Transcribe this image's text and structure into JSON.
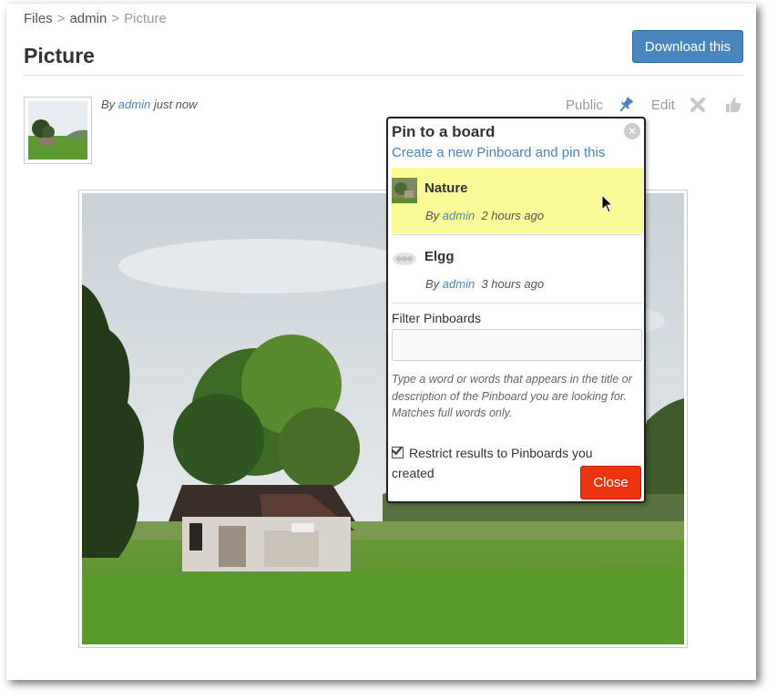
{
  "breadcrumb": {
    "files": "Files",
    "sep1": ">",
    "admin": "admin",
    "sep2": ">",
    "current": "Picture"
  },
  "page": {
    "title": "Picture",
    "download_label": "Download this"
  },
  "byline": {
    "prefix": "By",
    "author": "admin",
    "time": "just  now"
  },
  "actions": {
    "public_label": "Public",
    "edit_label": "Edit"
  },
  "popup": {
    "title": "Pin to a board",
    "create_link": "Create a new Pinboard and pin this",
    "boards": [
      {
        "name": "Nature",
        "by": "By",
        "author": "admin",
        "time": "2 hours ago",
        "highlighted": true
      },
      {
        "name": "Elgg",
        "by": "By",
        "author": "admin",
        "time": "3 hours ago",
        "highlighted": false
      }
    ],
    "filter_label": "Filter Pinboards",
    "filter_value": "",
    "help_text": "Type a word or words that appears in the title or description of the Pinboard you are looking for. Matches full words only.",
    "restrict_label": "Restrict results to Pinboards you created",
    "restrict_checked": true,
    "close_label": "Close"
  },
  "colors": {
    "link": "#4a86bd",
    "download_button": "#4a86bd",
    "close_button": "#ee3311",
    "highlight": "#fafa99"
  },
  "icons": {
    "pin": "pin-icon",
    "delete": "delete-x-icon",
    "like": "thumbs-up-icon",
    "popup_close": "close-circle-icon"
  }
}
